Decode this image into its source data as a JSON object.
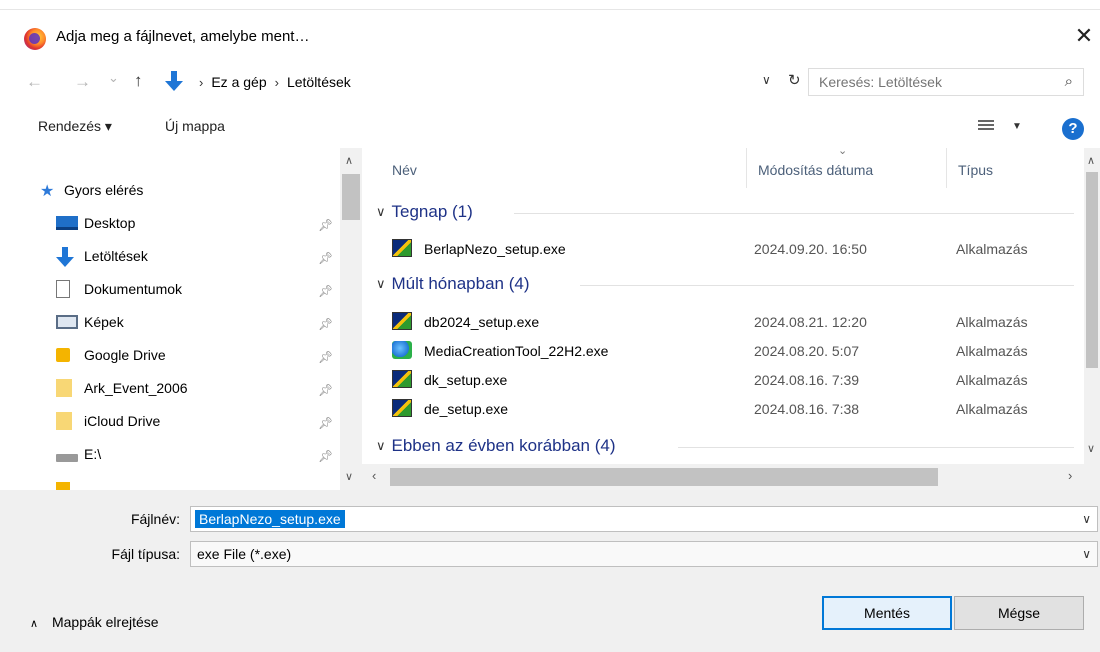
{
  "title": "Adja meg a fájlnevet, amelybe ment…",
  "nav": {
    "back": "←",
    "forward": "→",
    "recent": "⌄",
    "up": "↑",
    "crumbs": [
      "Ez a gép",
      "Letöltések"
    ],
    "search_placeholder": "Keresés: Letöltések"
  },
  "toolbar": {
    "organize": "Rendezés ▾",
    "new_folder": "Új mappa",
    "help": "?"
  },
  "sidebar": {
    "header": "Gyors elérés",
    "items": [
      {
        "label": "Desktop",
        "pinned": true
      },
      {
        "label": "Letöltések",
        "pinned": true
      },
      {
        "label": "Dokumentumok",
        "pinned": true
      },
      {
        "label": "Képek",
        "pinned": true
      },
      {
        "label": "Google Drive",
        "pinned": true
      },
      {
        "label": "Ark_Event_2006",
        "pinned": true
      },
      {
        "label": "iCloud Drive",
        "pinned": true
      },
      {
        "label": "E:\\",
        "pinned": true
      }
    ]
  },
  "columns": {
    "name": "Név",
    "date": "Módosítás dátuma",
    "type": "Típus"
  },
  "groups": [
    {
      "label": "Tegnap (1)",
      "files": [
        {
          "name": "BerlapNezo_setup.exe",
          "date": "2024.09.20. 16:50",
          "type": "Alkalmazás",
          "icon": "setup-icon"
        }
      ]
    },
    {
      "label": "Múlt hónapban (4)",
      "files": [
        {
          "name": "db2024_setup.exe",
          "date": "2024.08.21. 12:20",
          "type": "Alkalmazás",
          "icon": "setup-icon"
        },
        {
          "name": "MediaCreationTool_22H2.exe",
          "date": "2024.08.20. 5:07",
          "type": "Alkalmazás",
          "icon": "media-tool-icon"
        },
        {
          "name": "dk_setup.exe",
          "date": "2024.08.16. 7:39",
          "type": "Alkalmazás",
          "icon": "setup-icon"
        },
        {
          "name": "de_setup.exe",
          "date": "2024.08.16. 7:38",
          "type": "Alkalmazás",
          "icon": "setup-icon"
        }
      ]
    },
    {
      "label": "Ebben az évben korábban (4)",
      "files": []
    }
  ],
  "form": {
    "filename_label": "Fájlnév:",
    "filename_value": "BerlapNezo_setup.exe",
    "filetype_label": "Fájl típusa:",
    "filetype_value": "exe File (*.exe)"
  },
  "footer": {
    "hide_folders": "Mappák elrejtése",
    "save": "Mentés",
    "cancel": "Mégse"
  },
  "colors": {
    "accent": "#0078d7",
    "group_text": "#1e3287"
  }
}
